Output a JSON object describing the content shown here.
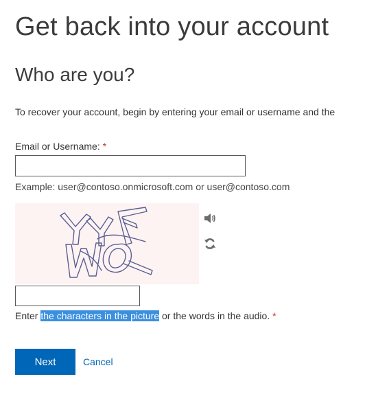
{
  "header": {
    "title": "Get back into your account"
  },
  "section": {
    "title": "Who are you?",
    "intro": "To recover your account, begin by entering your email or username and the"
  },
  "email_field": {
    "label": "Email or Username:",
    "required_mark": "*",
    "value": "",
    "example": "Example: user@contoso.onmicrosoft.com or user@contoso.com"
  },
  "captcha": {
    "image_text": "YYL WQ",
    "audio_icon": "speaker-icon",
    "refresh_icon": "refresh-icon",
    "input_value": "",
    "help_before": "Enter ",
    "help_selected": "the characters in the picture",
    "help_after": " or the words in the audio.",
    "required_mark": "*"
  },
  "actions": {
    "next_label": "Next",
    "cancel_label": "Cancel"
  },
  "colors": {
    "primary": "#0067b8",
    "selection": "#3a8fde",
    "captcha_bg": "#fdf3f3",
    "required": "#c0392b"
  }
}
